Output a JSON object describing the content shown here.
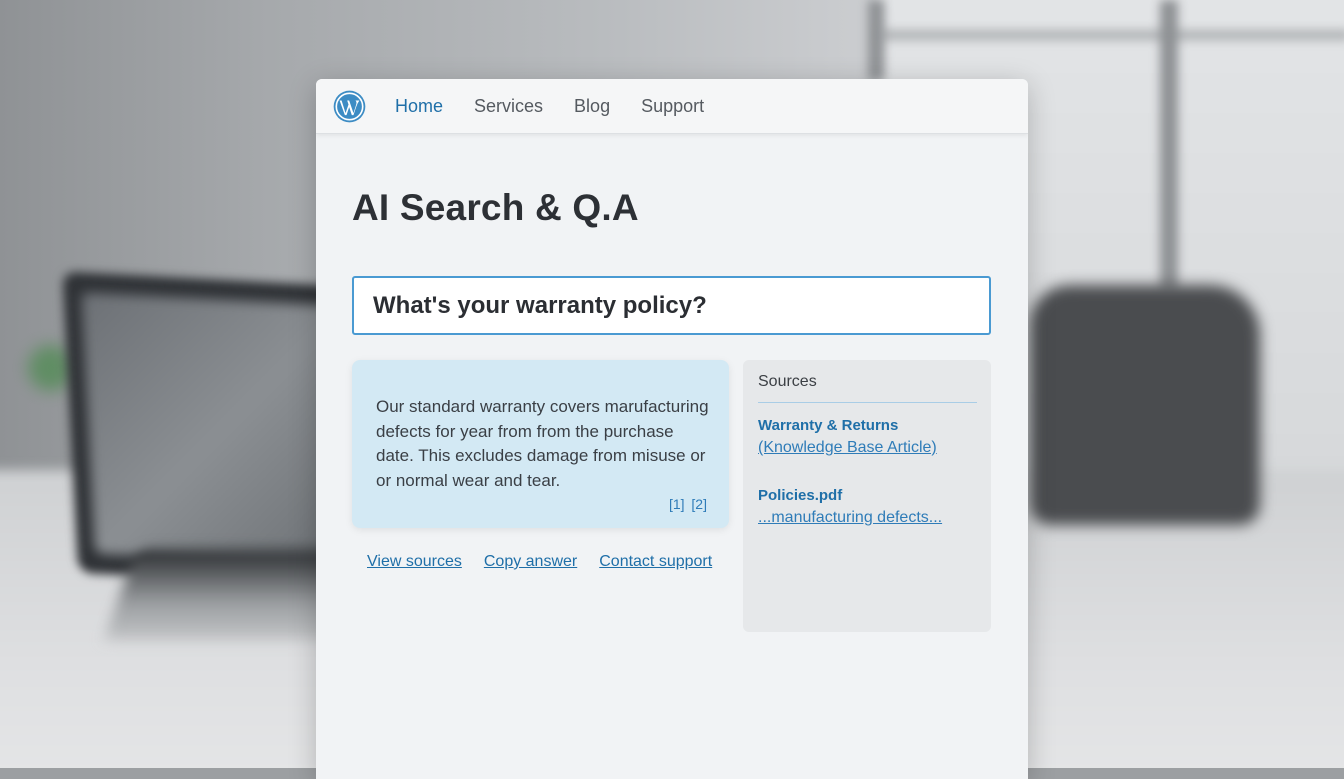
{
  "nav": {
    "logo_icon": "wordpress-logo-icon",
    "items": [
      {
        "label": "Home",
        "active": true
      },
      {
        "label": "Services",
        "active": false
      },
      {
        "label": "Blog",
        "active": false
      },
      {
        "label": "Support",
        "active": false
      }
    ]
  },
  "page": {
    "title": "AI Search & Q.A"
  },
  "search": {
    "value": "What's your warranty policy?"
  },
  "answer": {
    "text": "Our standard warranty covers marufacturing defects for year from from the purchase date. This excludes damage from misuse or or normal wear and tear.",
    "citations": [
      "[1]",
      "[2]"
    ]
  },
  "actions": {
    "view_sources": "View sources",
    "copy_answer": "Copy answer",
    "contact_support": "Contact support"
  },
  "sources": {
    "title": "Sources",
    "items": [
      {
        "title": "Warranty & Returns",
        "subtitle": "(Knowledge Base Article)"
      },
      {
        "title": "Policies.pdf",
        "subtitle": "...manufacturing defects..."
      }
    ]
  },
  "colors": {
    "accent": "#1f6fa8",
    "search_border": "#4a9ad2",
    "answer_bg": "#d3e9f4",
    "card_bg": "#f1f3f5"
  }
}
